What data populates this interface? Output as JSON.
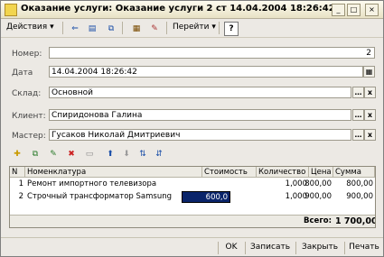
{
  "window": {
    "title": "Оказание услуги: Оказание услуги 2 ст 14.04.2004 18:26:42",
    "min": "_",
    "max": "□",
    "close": "×"
  },
  "toolbar": {
    "actions_label": "Действия",
    "goto_label": "Перейти",
    "help_label": "?"
  },
  "form": {
    "number_label": "Номер:",
    "number_value": "2",
    "date_label": "Дата",
    "date_value": "14.04.2004 18:26:42",
    "warehouse_label": "Склад:",
    "warehouse_value": "Основной",
    "client_label": "Клиент:",
    "client_value": "Спиридонова Галина",
    "master_label": "Мастер:",
    "master_value": "Гусаков Николай Дмитриевич"
  },
  "table": {
    "headers": [
      "N",
      "Номенклатура",
      "Стоимость",
      "Количество",
      "Цена",
      "Сумма"
    ],
    "rows": [
      {
        "n": "1",
        "item": "Ремонт импортного телевизора",
        "cost": "",
        "qty": "1,000",
        "price": "800,00",
        "sum": "800,00"
      },
      {
        "n": "2",
        "item": "Строчный трансформатор Samsung",
        "cost": "600,0",
        "qty": "1,000",
        "price": "900,00",
        "sum": "900,00"
      }
    ],
    "total_label": "Всего:",
    "total_value": "1 700,00"
  },
  "buttons": {
    "ok": "OK",
    "save": "Записать",
    "close": "Закрыть",
    "print": "Печать"
  },
  "colors": {
    "accent": "#0a246a",
    "title_bg": "#f0ebd4"
  }
}
